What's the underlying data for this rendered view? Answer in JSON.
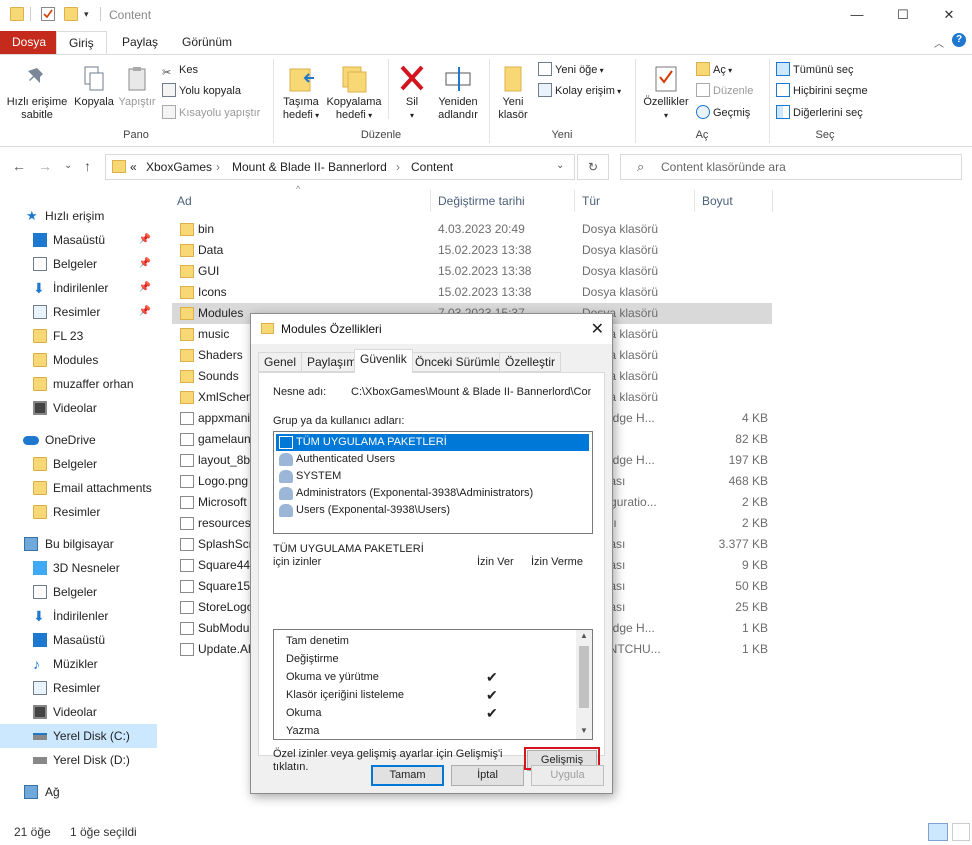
{
  "window": {
    "title": "Content",
    "controls": {
      "minimize": "—",
      "maximize": "☐",
      "close": "✕"
    }
  },
  "ribbon": {
    "tabs": [
      {
        "label": "Dosya"
      },
      {
        "label": "Giriş"
      },
      {
        "label": "Paylaş"
      },
      {
        "label": "Görünüm"
      }
    ],
    "pano": {
      "label": "Pano",
      "pin": "Hızlı erişime sabitle",
      "copy": "Kopyala",
      "paste": "Yapıştır",
      "cut": "Kes",
      "copy_path": "Yolu kopyala",
      "paste_shortcut": "Kısayolu yapıştır"
    },
    "duzenle": {
      "label": "Düzenle",
      "move_to": "Taşıma hedefi",
      "copy_to": "Kopyalama hedefi",
      "delete": "Sil",
      "rename": "Yeniden adlandır"
    },
    "yeni": {
      "label": "Yeni",
      "new_folder": "Yeni klasör",
      "new_item": "Yeni öğe",
      "easy_access": "Kolay erişim"
    },
    "ac": {
      "label": "Aç",
      "properties": "Özellikler",
      "open": "Aç",
      "edit": "Düzenle",
      "history": "Geçmiş"
    },
    "sec": {
      "label": "Seç",
      "select_all": "Tümünü seç",
      "select_none": "Hiçbirini seçme",
      "invert": "Diğerlerini seç"
    }
  },
  "address": {
    "prefix": "«",
    "crumbs": [
      "XboxGames",
      "Mount & Blade II- Bannerlord",
      "Content"
    ],
    "sep": "›",
    "search_placeholder": "Content klasöründe ara"
  },
  "sidebar": {
    "quick_access": "Hızlı erişim",
    "quick_items": [
      {
        "label": "Masaüstü"
      },
      {
        "label": "Belgeler"
      },
      {
        "label": "İndirilenler"
      },
      {
        "label": "Resimler"
      },
      {
        "label": "FL 23"
      },
      {
        "label": "Modules"
      },
      {
        "label": "muzaffer orhan"
      },
      {
        "label": "Videolar"
      }
    ],
    "onedrive": "OneDrive",
    "onedrive_items": [
      {
        "label": "Belgeler"
      },
      {
        "label": "Email attachments"
      },
      {
        "label": "Resimler"
      }
    ],
    "this_pc": "Bu bilgisayar",
    "pc_items": [
      {
        "label": "3D Nesneler"
      },
      {
        "label": "Belgeler"
      },
      {
        "label": "İndirilenler"
      },
      {
        "label": "Masaüstü"
      },
      {
        "label": "Müzikler"
      },
      {
        "label": "Resimler"
      },
      {
        "label": "Videolar"
      },
      {
        "label": "Yerel Disk (C:)"
      },
      {
        "label": "Yerel Disk (D:)"
      }
    ],
    "network": "Ağ"
  },
  "files": {
    "columns": {
      "name": "Ad",
      "date": "Değiştirme tarihi",
      "type": "Tür",
      "size": "Boyut"
    },
    "rows": [
      {
        "name": "bin",
        "date": "4.03.2023 20:49",
        "type": "Dosya klasörü",
        "size": ""
      },
      {
        "name": "Data",
        "date": "15.02.2023 13:38",
        "type": "Dosya klasörü",
        "size": ""
      },
      {
        "name": "GUI",
        "date": "15.02.2023 13:38",
        "type": "Dosya klasörü",
        "size": ""
      },
      {
        "name": "Icons",
        "date": "15.02.2023 13:38",
        "type": "Dosya klasörü",
        "size": ""
      },
      {
        "name": "Modules",
        "date": "7.03.2023 15:37",
        "type": "Dosya klasörü",
        "size": ""
      },
      {
        "name": "music",
        "date": "",
        "type": "Dosya klasörü",
        "size": ""
      },
      {
        "name": "Shaders",
        "date": "",
        "type": "Dosya klasörü",
        "size": ""
      },
      {
        "name": "Sounds",
        "date": "",
        "type": "Dosya klasörü",
        "size": ""
      },
      {
        "name": "XmlSchem",
        "date": "",
        "type": "Dosya klasörü",
        "size": ""
      },
      {
        "name": "appxmani",
        "date": "",
        "type": "soft Edge H...",
        "size": "4 KB"
      },
      {
        "name": "gamelaun",
        "date": "",
        "type": "ama",
        "size": "82 KB"
      },
      {
        "name": "layout_8b",
        "date": "",
        "type": "soft Edge H...",
        "size": "197 KB"
      },
      {
        "name": "Logo.png",
        "date": "",
        "type": "Dosyası",
        "size": "468 KB"
      },
      {
        "name": "Microsoft",
        "date": "",
        "type": "Configuratio...",
        "size": "2 KB"
      },
      {
        "name": "resources.",
        "date": "",
        "type": "osyası",
        "size": "2 KB"
      },
      {
        "name": "SplashScre",
        "date": "",
        "type": "Dosyası",
        "size": "3.377 KB"
      },
      {
        "name": "Square44x",
        "date": "",
        "type": "Dosyası",
        "size": "9 KB"
      },
      {
        "name": "Square150",
        "date": "",
        "type": "Dosyası",
        "size": "50 KB"
      },
      {
        "name": "StoreLogo",
        "date": "",
        "type": "Dosyası",
        "size": "25 KB"
      },
      {
        "name": "SubModu",
        "date": "",
        "type": "soft Edge H...",
        "size": "1 KB"
      },
      {
        "name": "Update.Al",
        "date": "",
        "type": "NMENTCHU...",
        "size": "1 KB"
      }
    ]
  },
  "status": {
    "count": "21 öğe",
    "selected": "1 öğe seçildi"
  },
  "dialog": {
    "title": "Modules Özellikleri",
    "tabs": [
      {
        "label": "Genel"
      },
      {
        "label": "Paylaşım"
      },
      {
        "label": "Güvenlik"
      },
      {
        "label": "Önceki Sürümler"
      },
      {
        "label": "Özelleştir"
      }
    ],
    "object_label": "Nesne adı:",
    "object_value": "C:\\XboxGames\\Mount & Blade II- Bannerlord\\Conte",
    "group_label": "Grup ya da kullanıcı adları:",
    "groups": [
      {
        "label": "TÜM UYGULAMA PAKETLERİ"
      },
      {
        "label": "Authenticated Users"
      },
      {
        "label": "SYSTEM"
      },
      {
        "label": "Administrators (Exponental-3938\\Administrators)"
      },
      {
        "label": "Users (Exponental-3938\\Users)"
      }
    ],
    "perm_title_1": "TÜM UYGULAMA PAKETLERİ",
    "perm_title_2": "için izinler",
    "allow": "İzin Ver",
    "deny": "İzin Verme",
    "permissions": [
      {
        "label": "Tam denetim",
        "allow": ""
      },
      {
        "label": "Değiştirme",
        "allow": ""
      },
      {
        "label": "Okuma ve yürütme",
        "allow": "✔"
      },
      {
        "label": "Klasör içeriğini listeleme",
        "allow": "✔"
      },
      {
        "label": "Okuma",
        "allow": "✔"
      },
      {
        "label": "Yazma",
        "allow": ""
      }
    ],
    "advanced_text_1": "Özel izinler veya gelişmiş ayarlar için Gelişmiş'i",
    "advanced_text_2": "tıklatın.",
    "advanced_btn": "Gelişmiş",
    "ok": "Tamam",
    "cancel": "İptal",
    "apply": "Uygula"
  },
  "colors": {
    "file_tab": "#c42b1c",
    "selection": "#0078d7",
    "highlight": "#d3151f"
  }
}
